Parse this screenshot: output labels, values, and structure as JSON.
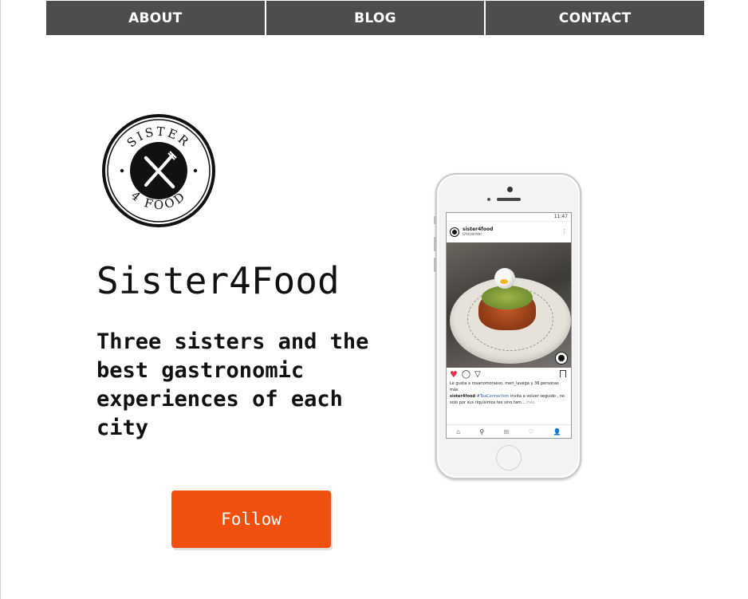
{
  "nav": {
    "items": [
      {
        "label": "ABOUT"
      },
      {
        "label": "BLOG"
      },
      {
        "label": "CONTACT"
      }
    ]
  },
  "logo": {
    "top_text": "SISTER",
    "bottom_text": "4 FOOD",
    "icon": "fork-knife-icon"
  },
  "hero": {
    "title": "Sister4Food",
    "tagline": "Three sisters and the best gastronomic experiences of each city",
    "follow_label": "Follow"
  },
  "phone_screen": {
    "status_time": "11:47",
    "post_user": "sister4food",
    "post_location": "Unicenter",
    "likes_text": "Le gusta a rosariomorasso, meri_lavega y 36 personas más",
    "caption_user": "sister4food",
    "caption_tag": "#TeaConnection",
    "caption_text": "invita a volver seguido",
    "caption_text2": ", no solo por sus riquísimos tes sino tam...",
    "caption_more": "más"
  },
  "colors": {
    "nav_bg": "#4d4d4d",
    "accent": "#f0500f"
  }
}
